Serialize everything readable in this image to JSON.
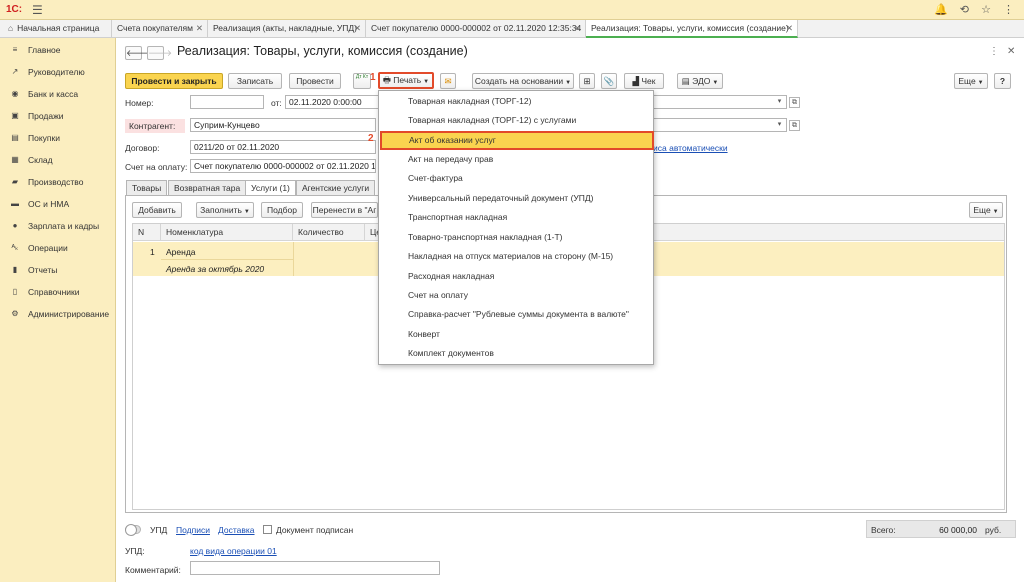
{
  "app": {
    "logo": "1С:",
    "menu_icon": "hamburger-icon",
    "icons": {
      "bell": "🔔",
      "history": "⟲",
      "star": "☆",
      "dots": "⋮"
    }
  },
  "tabs": [
    {
      "label": "Начальная страница",
      "home": "⌂"
    },
    {
      "label": "Счета покупателям"
    },
    {
      "label": "Реализация (акты, накладные, УПД)"
    },
    {
      "label": "Счет покупателю 0000-000002 от 02.11.2020 12:35:34"
    },
    {
      "label": "Реализация: Товары, услуги, комиссия (создание)"
    }
  ],
  "sidebar": {
    "items": [
      {
        "label": "Главное",
        "icon": "≡"
      },
      {
        "label": "Руководителю",
        "icon": "↗"
      },
      {
        "label": "Банк и касса",
        "icon": "◉"
      },
      {
        "label": "Продажи",
        "icon": "▣"
      },
      {
        "label": "Покупки",
        "icon": "▤"
      },
      {
        "label": "Склад",
        "icon": "▦"
      },
      {
        "label": "Производство",
        "icon": "▰"
      },
      {
        "label": "ОС и НМА",
        "icon": "▬"
      },
      {
        "label": "Зарплата и кадры",
        "icon": "●"
      },
      {
        "label": "Операции",
        "icon": "ᴬₖ"
      },
      {
        "label": "Отчеты",
        "icon": "▮"
      },
      {
        "label": "Справочники",
        "icon": "▯"
      },
      {
        "label": "Администрирование",
        "icon": "⚙"
      }
    ]
  },
  "document": {
    "title": "Реализация: Товары, услуги, комиссия (создание)",
    "nav_back": "🡐",
    "nav_forward": "🡒",
    "win_dots": "⋮",
    "win_close": "✕"
  },
  "toolbar": {
    "post_close": "Провести и закрыть",
    "save": "Записать",
    "post": "Провести",
    "dtkt": "Дт Кт",
    "print": "Печать",
    "print_icon": "🖶",
    "mail_icon": "✉",
    "create_based": "Создать на основании",
    "receipt": "Чек",
    "edo": "ЭДО",
    "more": "Еще",
    "help": "?"
  },
  "form": {
    "number_label": "Номер:",
    "number_value": "",
    "date_label": "от:",
    "date_value": "02.11.2020  0:00:00",
    "contractor_label": "Контрагент:",
    "contractor_value": "Суприм-Кунцево",
    "contract_label": "Договор:",
    "contract_value": "0211/20 от 02.11.2020",
    "invoice_label": "Счет на оплату:",
    "invoice_value": "Счет покупателю 0000-000002 от 02.11.2020 12:35:34",
    "auto_link": "иса автоматически"
  },
  "doc_tabs": [
    {
      "label": "Товары"
    },
    {
      "label": "Возвратная тара"
    },
    {
      "label": "Услуги (1)"
    },
    {
      "label": "Агентские услуги"
    }
  ],
  "grid_toolbar": {
    "add": "Добавить",
    "fill": "Заполнить",
    "select": "Подбор",
    "move": "Перенести в \"Аг",
    "more": "Еще"
  },
  "grid": {
    "columns": [
      "N",
      "Номенклатура",
      "Количество",
      "Це"
    ],
    "rows": [
      {
        "n": "1",
        "name": "Аренда",
        "detail": "Аренда за октябрь 2020"
      }
    ]
  },
  "print_menu": {
    "items": [
      "Товарная накладная (ТОРГ-12)",
      "Товарная накладная (ТОРГ-12) с услугами",
      "Акт об оказании услуг",
      "Акт на передачу прав",
      "Счет-фактура",
      "Универсальный передаточный документ (УПД)",
      "Транспортная накладная",
      "Товарно-транспортная накладная (1-Т)",
      "Накладная на отпуск материалов на сторону (М-15)",
      "Расходная накладная",
      "Счет на оплату",
      "Справка-расчет \"Рублевые суммы документа в валюте\"",
      "Конверт",
      "Комплект документов"
    ],
    "selected_index": 2,
    "badge_print": "1",
    "badge_item": "2"
  },
  "footer": {
    "upd_toggle_label": "УПД",
    "signatures_link": "Подписи",
    "delivery_link": "Доставка",
    "signed_label": "Документ подписан",
    "total_label": "Всего:",
    "total_value": "60 000,00",
    "currency": "руб.",
    "upd_label": "УПД:",
    "operation_link": "код вида операции 01",
    "comment_label": "Комментарий:",
    "comment_value": ""
  }
}
